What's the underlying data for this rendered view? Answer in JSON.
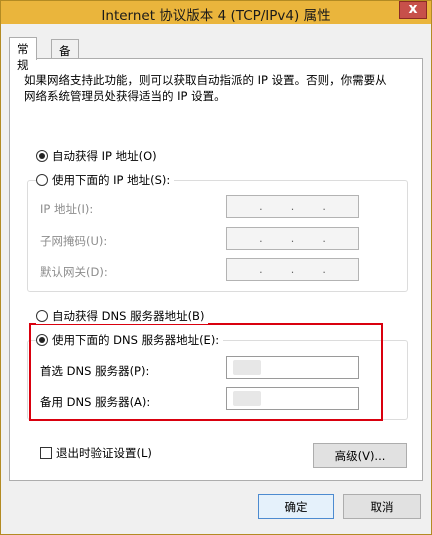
{
  "window": {
    "title": "Internet 协议版本 4 (TCP/IPv4) 属性",
    "close_glyph": "x"
  },
  "tabs": [
    {
      "label": "常规",
      "active": true
    },
    {
      "label": "备用配置",
      "active": false
    }
  ],
  "description": "如果网络支持此功能，则可以获取自动指派的 IP 设置。否则，你需要从网络系统管理员处获得适当的 IP 设置。",
  "ip_section": {
    "auto_label": "自动获得 IP 地址(O)",
    "auto_selected": true,
    "manual_label": "使用下面的 IP 地址(S):",
    "manual_selected": false,
    "fields": [
      {
        "label": "IP 地址(I):",
        "value": ".    .    ."
      },
      {
        "label": "子网掩码(U):",
        "value": ".    .    ."
      },
      {
        "label": "默认网关(D):",
        "value": ".    .    ."
      }
    ]
  },
  "dns_section": {
    "auto_label": "自动获得 DNS 服务器地址(B)",
    "auto_selected": false,
    "manual_label": "使用下面的 DNS 服务器地址(E):",
    "manual_selected": true,
    "fields": [
      {
        "label": "首选 DNS 服务器(P):",
        "value": ""
      },
      {
        "label": "备用 DNS 服务器(A):",
        "value": ""
      }
    ]
  },
  "validate_checkbox": {
    "label": "退出时验证设置(L)",
    "checked": false
  },
  "buttons": {
    "advanced": "高级(V)...",
    "ok": "确定",
    "cancel": "取消"
  }
}
